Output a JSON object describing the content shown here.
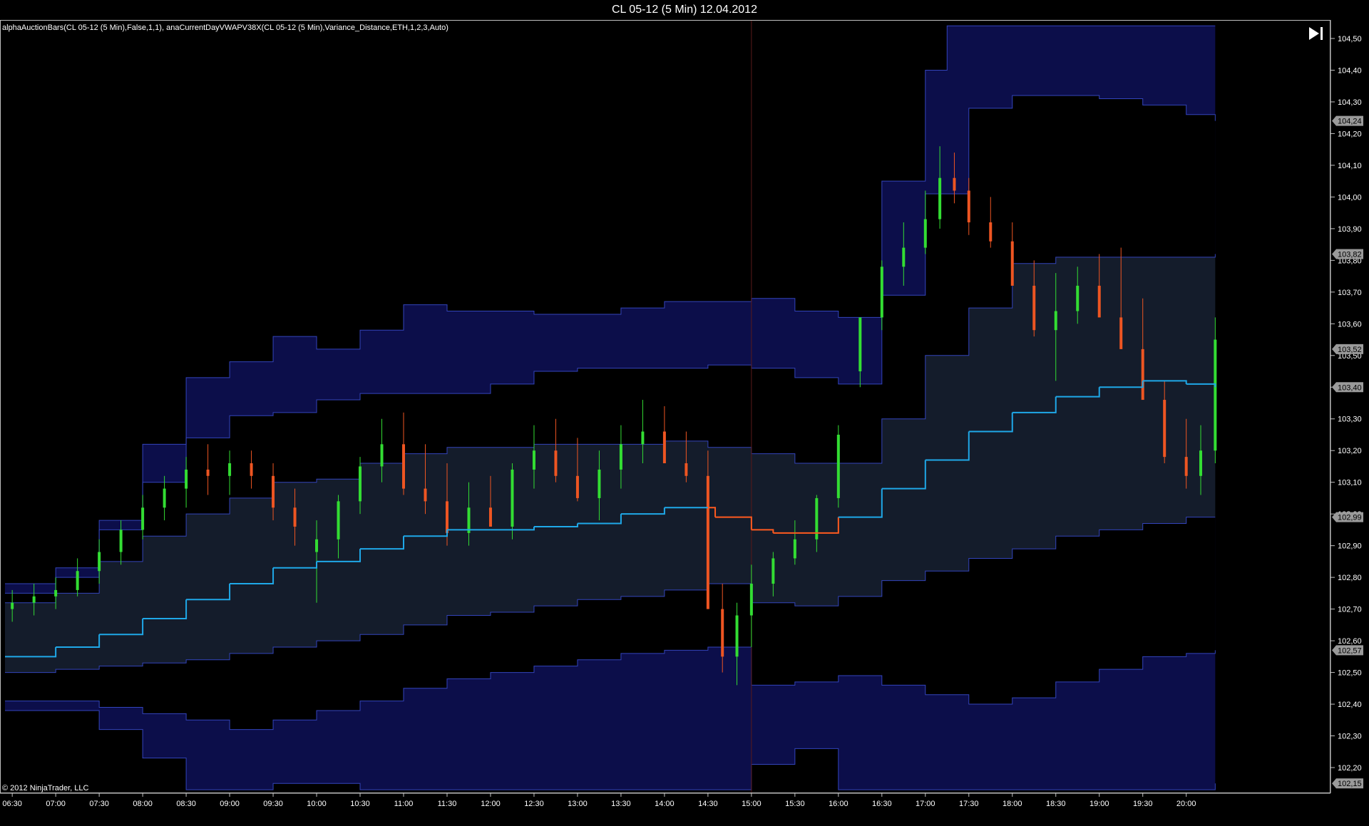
{
  "window": {
    "title": "CL 05-12 (5 Min)  12.04.2012"
  },
  "indicator_label": "alphaAuctionBars(CL 05-12 (5 Min),False,1,1), anaCurrentDayVWAPV38X(CL 05-12 (5 Min),Variance_Distance,ETH,1,2,3,Auto)",
  "copyright": "© 2012 NinjaTrader, LLC",
  "toolbar": {
    "scroll_to_end_icon": "skip-to-end-icon"
  },
  "colors": {
    "background": "#000000",
    "outer_band": "#0c0e4a",
    "mid_band": "#000000",
    "inner_band": "#141c2b",
    "band_line": "#3344bb",
    "vwap_up": "#1fa8e8",
    "vwap_down": "#ff5a1f",
    "bull_candle": "#33dd33",
    "bear_candle": "#ee5522",
    "neutral_candle": "#ffffff",
    "price_marker": "#9a9a9a"
  },
  "chart_data": {
    "type": "candlestick",
    "title": "CL 05-12 (5 Min)  12.04.2012",
    "x_tick_labels": [
      "06:30",
      "07:00",
      "07:30",
      "08:00",
      "08:30",
      "09:00",
      "09:30",
      "10:00",
      "10:30",
      "11:00",
      "11:30",
      "12:00",
      "12:30",
      "13:00",
      "13:30",
      "14:00",
      "14:30",
      "15:00",
      "15:30",
      "16:00",
      "16:30",
      "17:00",
      "17:30",
      "18:00",
      "18:30",
      "19:00",
      "19:30",
      "20:00"
    ],
    "y_tick_labels": [
      "104,50",
      "104,40",
      "104,30",
      "104,20",
      "104,10",
      "104,00",
      "103,90",
      "103,80",
      "103,70",
      "103,60",
      "103,50",
      "103,40",
      "103,30",
      "103,20",
      "103,10",
      "103,00",
      "102,90",
      "102,80",
      "102,70",
      "102,60",
      "102,50",
      "102,40",
      "102,30",
      "102,20"
    ],
    "ylim": [
      102.13,
      104.54
    ],
    "price_markers": [
      "104,24",
      "103,82",
      "103,52",
      "103,40",
      "102,99",
      "102,57",
      "102,15"
    ],
    "current_price": "103,40",
    "grid": false,
    "series": [
      {
        "name": "VWAP",
        "times": [
          "06:25",
          "07:00",
          "07:30",
          "08:00",
          "08:30",
          "09:00",
          "09:30",
          "10:00",
          "10:30",
          "11:00",
          "11:30",
          "12:00",
          "12:30",
          "13:00",
          "13:30",
          "14:00",
          "14:30",
          "14:35",
          "15:00",
          "15:15",
          "15:30",
          "15:45",
          "16:00",
          "16:30",
          "17:00",
          "17:30",
          "18:00",
          "18:30",
          "19:00",
          "19:30",
          "20:00",
          "20:20"
        ],
        "values": [
          102.55,
          102.58,
          102.62,
          102.67,
          102.73,
          102.78,
          102.83,
          102.85,
          102.89,
          102.93,
          102.95,
          102.95,
          102.96,
          102.97,
          103.0,
          103.02,
          103.02,
          102.99,
          102.95,
          102.94,
          102.94,
          102.94,
          102.99,
          103.08,
          103.17,
          103.26,
          103.32,
          103.37,
          103.4,
          103.42,
          103.41,
          103.4
        ]
      },
      {
        "name": "Upper Band 1",
        "times": [
          "06:25",
          "07:00",
          "07:30",
          "08:00",
          "08:30",
          "09:00",
          "09:30",
          "10:00",
          "10:30",
          "11:00",
          "11:30",
          "12:00",
          "12:30",
          "13:00",
          "13:30",
          "14:00",
          "14:30",
          "15:00",
          "15:30",
          "16:00",
          "16:30",
          "17:00",
          "17:30",
          "18:00",
          "18:30",
          "19:00",
          "19:30",
          "20:00",
          "20:20"
        ],
        "values": [
          102.72,
          102.75,
          102.85,
          102.93,
          103.0,
          103.05,
          103.1,
          103.11,
          103.16,
          103.19,
          103.21,
          103.21,
          103.22,
          103.22,
          103.22,
          103.23,
          103.21,
          103.19,
          103.16,
          103.16,
          103.3,
          103.5,
          103.65,
          103.79,
          103.81,
          103.81,
          103.81,
          103.81,
          103.82
        ]
      },
      {
        "name": "Lower Band 1",
        "times": [
          "06:25",
          "07:00",
          "07:30",
          "08:00",
          "08:30",
          "09:00",
          "09:30",
          "10:00",
          "10:30",
          "11:00",
          "11:30",
          "12:00",
          "12:30",
          "13:00",
          "13:30",
          "14:00",
          "14:30",
          "15:00",
          "15:30",
          "16:00",
          "16:30",
          "17:00",
          "17:30",
          "18:00",
          "18:30",
          "19:00",
          "19:30",
          "20:00",
          "20:20"
        ],
        "values": [
          102.5,
          102.51,
          102.52,
          102.53,
          102.54,
          102.56,
          102.58,
          102.6,
          102.62,
          102.65,
          102.68,
          102.69,
          102.71,
          102.73,
          102.74,
          102.76,
          102.78,
          102.72,
          102.71,
          102.74,
          102.79,
          102.82,
          102.86,
          102.89,
          102.93,
          102.95,
          102.97,
          102.99,
          102.99
        ]
      },
      {
        "name": "Upper Band 2",
        "times": [
          "06:25",
          "07:00",
          "07:30",
          "08:00",
          "08:30",
          "09:00",
          "09:30",
          "10:00",
          "10:30",
          "11:00",
          "11:30",
          "12:00",
          "12:30",
          "13:00",
          "13:30",
          "14:00",
          "14:30",
          "15:00",
          "15:30",
          "16:00",
          "16:30",
          "17:00",
          "17:30",
          "18:00",
          "18:30",
          "19:00",
          "19:30",
          "20:00",
          "20:20"
        ],
        "values": [
          102.75,
          102.8,
          102.95,
          103.1,
          103.24,
          103.31,
          103.32,
          103.36,
          103.38,
          103.38,
          103.38,
          103.41,
          103.45,
          103.46,
          103.46,
          103.46,
          103.47,
          103.46,
          103.43,
          103.41,
          103.69,
          104.01,
          104.28,
          104.32,
          104.32,
          104.31,
          104.29,
          104.26,
          104.24
        ]
      },
      {
        "name": "Lower Band 2",
        "times": [
          "06:25",
          "07:00",
          "07:30",
          "08:00",
          "08:30",
          "09:00",
          "09:30",
          "10:00",
          "10:30",
          "11:00",
          "11:30",
          "12:00",
          "12:30",
          "13:00",
          "13:30",
          "14:00",
          "14:30",
          "15:00",
          "15:30",
          "16:00",
          "16:30",
          "17:00",
          "17:30",
          "18:00",
          "18:30",
          "19:00",
          "19:30",
          "20:00",
          "20:20"
        ],
        "values": [
          102.41,
          102.41,
          102.39,
          102.37,
          102.35,
          102.32,
          102.35,
          102.38,
          102.41,
          102.45,
          102.48,
          102.5,
          102.52,
          102.54,
          102.56,
          102.57,
          102.58,
          102.46,
          102.47,
          102.49,
          102.46,
          102.43,
          102.4,
          102.42,
          102.47,
          102.51,
          102.55,
          102.56,
          102.57
        ]
      },
      {
        "name": "Upper Band 3",
        "times": [
          "06:25",
          "07:00",
          "07:30",
          "08:00",
          "08:30",
          "09:00",
          "09:30",
          "10:00",
          "10:30",
          "11:00",
          "11:30",
          "12:00",
          "12:30",
          "13:00",
          "13:30",
          "14:00",
          "14:30",
          "15:00",
          "15:30",
          "16:00",
          "16:30",
          "17:00",
          "17:15",
          "17:30",
          "18:00",
          "18:30",
          "19:00",
          "19:30",
          "20:00",
          "20:20"
        ],
        "values": [
          102.78,
          102.83,
          102.98,
          103.22,
          103.43,
          103.48,
          103.56,
          103.52,
          103.58,
          103.66,
          103.64,
          103.64,
          103.63,
          103.63,
          103.65,
          103.67,
          103.67,
          103.68,
          103.64,
          103.62,
          104.05,
          104.4,
          104.54,
          104.54,
          104.54,
          104.54,
          104.54,
          104.54,
          104.54,
          104.54
        ]
      },
      {
        "name": "Lower Band 3",
        "times": [
          "06:25",
          "07:00",
          "07:30",
          "08:00",
          "08:30",
          "09:00",
          "09:30",
          "10:00",
          "10:30",
          "11:00",
          "11:30",
          "12:00",
          "12:30",
          "13:00",
          "13:30",
          "14:00",
          "14:30",
          "15:00",
          "15:30",
          "16:00",
          "16:30",
          "17:00",
          "17:30",
          "18:00",
          "18:30",
          "19:00",
          "19:30",
          "20:00",
          "20:20"
        ],
        "values": [
          102.38,
          102.38,
          102.32,
          102.23,
          102.13,
          102.13,
          102.15,
          102.15,
          102.13,
          102.13,
          102.13,
          102.13,
          102.13,
          102.13,
          102.13,
          102.13,
          102.13,
          102.21,
          102.26,
          102.13,
          102.13,
          102.13,
          102.13,
          102.13,
          102.13,
          102.13,
          102.13,
          102.13,
          102.15
        ]
      }
    ],
    "candles": {
      "times": [
        "06:30",
        "06:45",
        "07:00",
        "07:15",
        "07:30",
        "07:45",
        "08:00",
        "08:15",
        "08:30",
        "08:45",
        "09:00",
        "09:15",
        "09:30",
        "09:45",
        "10:00",
        "10:15",
        "10:30",
        "10:45",
        "11:00",
        "11:15",
        "11:30",
        "11:45",
        "12:00",
        "12:15",
        "12:30",
        "12:45",
        "13:00",
        "13:15",
        "13:30",
        "13:45",
        "14:00",
        "14:15",
        "14:30",
        "14:40",
        "14:50",
        "15:00",
        "15:15",
        "15:30",
        "15:45",
        "16:00",
        "16:15",
        "16:30",
        "16:45",
        "17:00",
        "17:10",
        "17:20",
        "17:30",
        "17:45",
        "18:00",
        "18:15",
        "18:30",
        "18:45",
        "19:00",
        "19:15",
        "19:30",
        "19:45",
        "20:00",
        "20:10",
        "20:20"
      ],
      "open": [
        102.7,
        102.72,
        102.74,
        102.76,
        102.82,
        102.88,
        102.95,
        103.02,
        103.08,
        103.14,
        103.12,
        103.16,
        103.12,
        103.02,
        102.88,
        102.92,
        103.04,
        103.15,
        103.22,
        103.08,
        103.04,
        102.94,
        103.02,
        102.96,
        103.14,
        103.2,
        103.12,
        103.05,
        103.14,
        103.22,
        103.26,
        103.16,
        103.12,
        102.7,
        102.55,
        102.68,
        102.78,
        102.86,
        102.92,
        103.05,
        103.45,
        103.62,
        103.78,
        103.84,
        103.93,
        104.06,
        104.02,
        103.92,
        103.86,
        103.72,
        103.58,
        103.64,
        103.72,
        103.62,
        103.52,
        103.36,
        103.18,
        103.12,
        103.2
      ],
      "high": [
        102.76,
        102.78,
        102.8,
        102.86,
        102.92,
        102.98,
        103.06,
        103.12,
        103.18,
        103.22,
        103.2,
        103.2,
        103.16,
        103.08,
        102.98,
        103.06,
        103.18,
        103.3,
        103.32,
        103.22,
        103.16,
        103.1,
        103.12,
        103.16,
        103.28,
        103.3,
        103.24,
        103.2,
        103.28,
        103.36,
        103.34,
        103.26,
        103.2,
        102.78,
        102.72,
        102.84,
        102.88,
        102.98,
        103.06,
        103.28,
        103.62,
        103.8,
        103.92,
        104.02,
        104.16,
        104.14,
        104.06,
        104.0,
        103.92,
        103.8,
        103.76,
        103.78,
        103.82,
        103.84,
        103.68,
        103.42,
        103.3,
        103.28,
        103.62
      ],
      "low": [
        102.66,
        102.68,
        102.7,
        102.74,
        102.78,
        102.84,
        102.92,
        102.98,
        103.02,
        103.06,
        103.06,
        103.08,
        102.98,
        102.9,
        102.72,
        102.86,
        103.0,
        103.1,
        103.06,
        103.0,
        102.9,
        102.9,
        102.96,
        102.92,
        103.08,
        103.1,
        103.04,
        102.98,
        103.08,
        103.16,
        103.16,
        103.1,
        102.8,
        102.5,
        102.46,
        102.58,
        102.74,
        102.84,
        102.88,
        103.02,
        103.4,
        103.58,
        103.72,
        103.82,
        103.9,
        103.98,
        103.88,
        103.84,
        103.78,
        103.56,
        103.42,
        103.6,
        103.64,
        103.54,
        103.46,
        103.16,
        103.08,
        103.06,
        103.16
      ],
      "close": [
        102.72,
        102.74,
        102.76,
        102.82,
        102.88,
        102.95,
        103.02,
        103.08,
        103.14,
        103.12,
        103.16,
        103.12,
        103.02,
        102.96,
        102.92,
        103.04,
        103.15,
        103.22,
        103.08,
        103.04,
        102.94,
        103.02,
        102.96,
        103.14,
        103.2,
        103.12,
        103.05,
        103.14,
        103.22,
        103.26,
        103.16,
        103.12,
        102.7,
        102.55,
        102.68,
        102.78,
        102.86,
        102.92,
        103.05,
        103.25,
        103.62,
        103.78,
        103.84,
        103.93,
        104.06,
        104.02,
        103.92,
        103.86,
        103.72,
        103.58,
        103.64,
        103.72,
        103.62,
        103.52,
        103.36,
        103.18,
        103.12,
        103.2,
        103.55
      ]
    }
  }
}
